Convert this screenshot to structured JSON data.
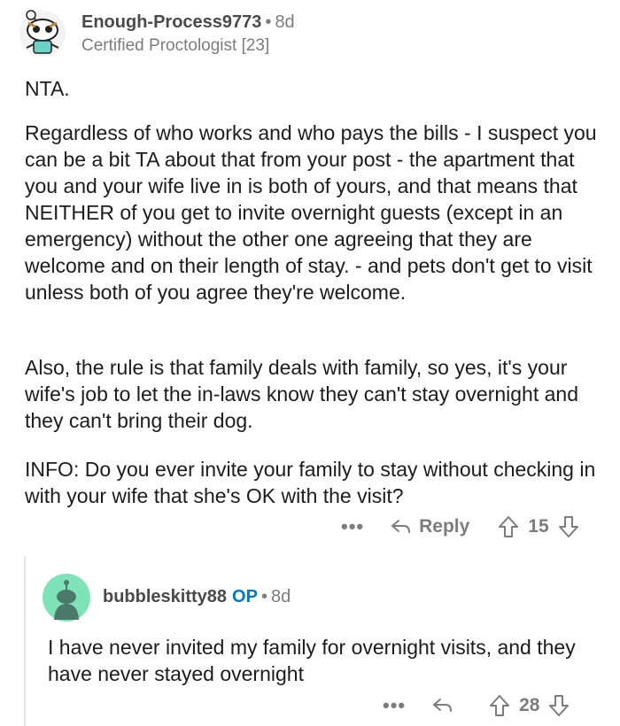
{
  "comment": {
    "username": "Enough-Process9773",
    "separator": "•",
    "age": "8d",
    "flair": "Certified Proctologist [23]",
    "paragraphs": [
      "NTA.",
      "Regardless of who works and who pays the bills - I suspect you can be a bit TA about that from your post - the apartment that you and your wife live in is both of yours, and that means that NEITHER of you get to invite overnight guests (except in an emergency) without the other one agreeing that they are welcome and on their length of stay. - and pets don't get to visit unless both of you agree they're welcome.",
      "Also, the rule is that family deals with family, so yes, it's your wife's job to let the in-laws know they can't stay overnight and they can't bring their dog.",
      "INFO: Do you ever invite your family to stay without checking in with your wife that she's OK with the visit?"
    ],
    "more_label": "•••",
    "reply_label": "Reply",
    "score": "15"
  },
  "reply": {
    "username": "bubbleskitty88",
    "op_badge": "OP",
    "separator": "•",
    "age": "8d",
    "text": "I have never invited my family for overnight visits, and they have never stayed overnight",
    "more_label": "•••",
    "score": "28"
  },
  "colors": {
    "op_blue": "#0079d3",
    "muted": "#7c7c7c",
    "avatar_green": "#7fe3b8"
  }
}
